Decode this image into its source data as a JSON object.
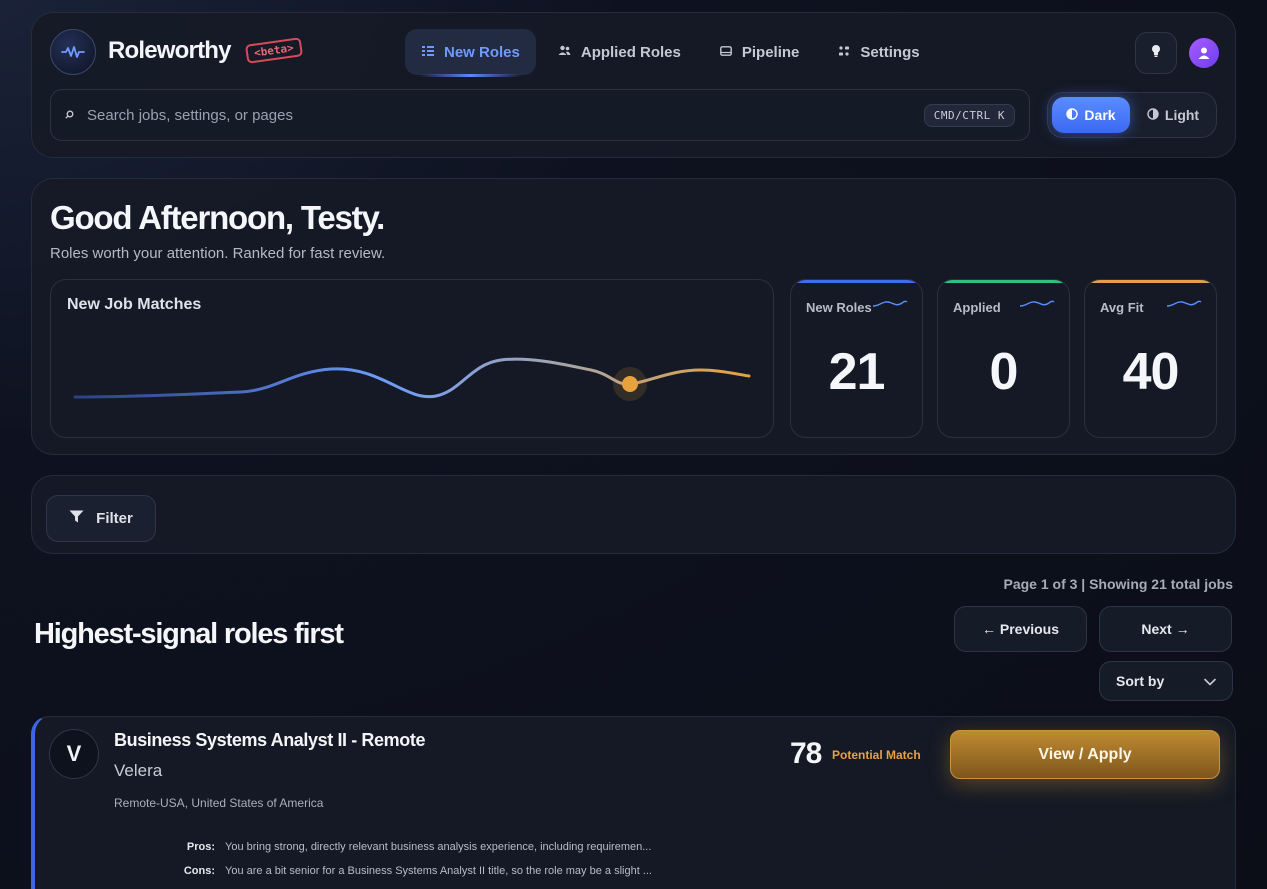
{
  "brand": {
    "name": "Roleworthy",
    "tag": "<beta>"
  },
  "nav": {
    "items": [
      {
        "label": "New Roles",
        "icon": "list-icon",
        "active": true
      },
      {
        "label": "Applied Roles",
        "icon": "users-icon",
        "active": false
      },
      {
        "label": "Pipeline",
        "icon": "inbox-icon",
        "active": false
      },
      {
        "label": "Settings",
        "icon": "grid-icon",
        "active": false
      }
    ]
  },
  "search": {
    "placeholder": "Search jobs, settings, or pages",
    "shortcut": "CMD/CTRL K"
  },
  "theme": {
    "dark_label": "Dark",
    "light_label": "Light",
    "selected": "Dark"
  },
  "hero": {
    "greeting": "Good Afternoon, Testy.",
    "subline": "Roles worth your attention. Ranked for fast review.",
    "chart_title": "New Job Matches"
  },
  "stats": [
    {
      "label": "New Roles",
      "value": "21",
      "color": "#3b6ef0"
    },
    {
      "label": "Applied",
      "value": "0",
      "color": "#2ec27e"
    },
    {
      "label": "Avg Fit",
      "value": "40",
      "color": "#e0a050"
    }
  ],
  "filter": {
    "label": "Filter"
  },
  "listing": {
    "page_info": "Page 1 of 3 | Showing 21 total jobs",
    "title": "Highest-signal roles first",
    "prev_label": "← Previous",
    "next_label": "Next →",
    "sort_label": "Sort by"
  },
  "job": {
    "initial": "V",
    "title": "Business Systems Analyst II - Remote",
    "company": "Velera",
    "location": "Remote-USA, United States of America",
    "score": "78",
    "score_label": "Potential Match",
    "apply_label": "View / Apply",
    "pros_label": "Pros:",
    "pros": "You bring strong, directly relevant business analysis experience, including requiremen...",
    "cons_label": "Cons:",
    "cons": "You are a bit senior for a Business Systems Analyst II title, so the role may be a slight ..."
  },
  "colors": {
    "accent": "#5b8cff",
    "apply": "#c08a32",
    "warn": "#e7a23c"
  }
}
